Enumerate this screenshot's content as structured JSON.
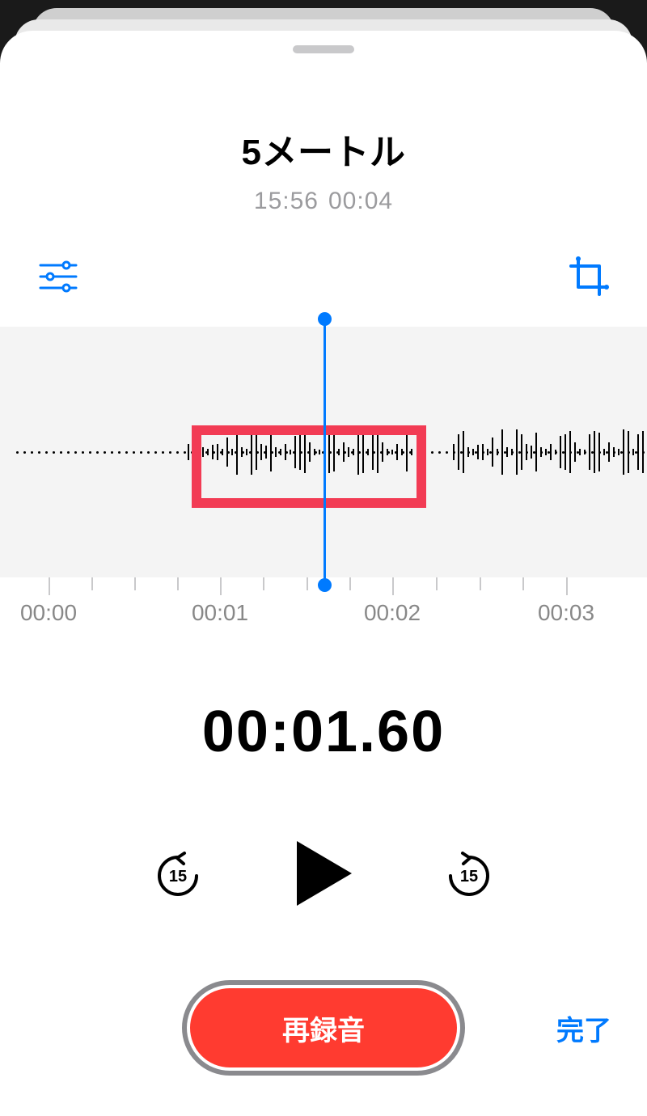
{
  "recording": {
    "title": "5メートル",
    "timestamp": "15:56",
    "duration": "00:04"
  },
  "playhead_time": "00:01.60",
  "ruler": {
    "labels": [
      "00:00",
      "00:01",
      "00:02",
      "00:03"
    ]
  },
  "skip_seconds": "15",
  "buttons": {
    "rerecord": "再録音",
    "done": "完了"
  },
  "colors": {
    "accent": "#007aff",
    "record": "#ff3b30",
    "highlight": "#f23b54"
  }
}
